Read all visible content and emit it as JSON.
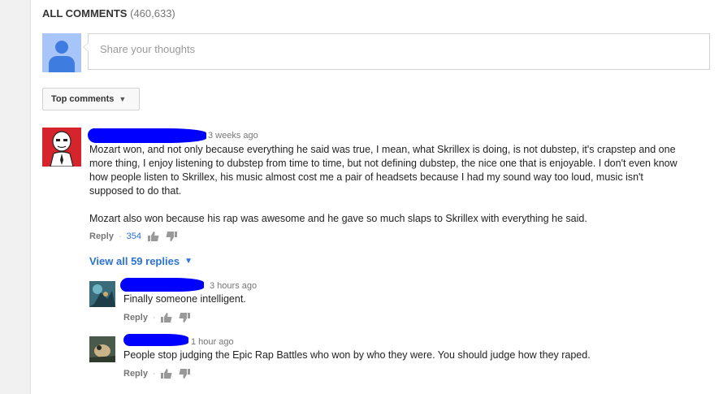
{
  "header": {
    "title": "ALL COMMENTS",
    "count": "(460,633)"
  },
  "share": {
    "placeholder": "Share your thoughts"
  },
  "sort": {
    "label": "Top comments"
  },
  "comments": [
    {
      "time": "3 weeks ago",
      "paragraph1_line1": "Mozart won, and not only because everything he said was true, I mean, what Skrillex is doing, is not dubstep, it's crapstep and one",
      "paragraph1_line2": "more thing, I enjoy listening to dubstep from time to time, but not defining dubstep, the nice one that is enjoyable. I don't even know",
      "paragraph1_line3": "how people listen to Skrillex, his music almost cost me a pair of headsets because I had my sound way too loud, music isn't",
      "paragraph1_line4": "supposed to do that.",
      "paragraph2": "Mozart also won because his rap was awesome and he gave so much slaps to Skrillex with everything he said.",
      "reply_label": "Reply",
      "dot": "·",
      "likes": "354"
    }
  ],
  "view_replies": {
    "label": "View all 59 replies"
  },
  "replies": [
    {
      "time": "3 hours ago",
      "text": "Finally someone intelligent.",
      "reply_label": "Reply",
      "dot": "·"
    },
    {
      "time": "1 hour ago",
      "text": "People stop judging the Epic Rap Battles who won by who they were. You should judge how they raped.",
      "reply_label": "Reply",
      "dot": "·"
    }
  ],
  "colors": {
    "link_blue": "#2b72d7",
    "redaction_blue": "#0000ff",
    "avatar_red": "#d6242c"
  }
}
